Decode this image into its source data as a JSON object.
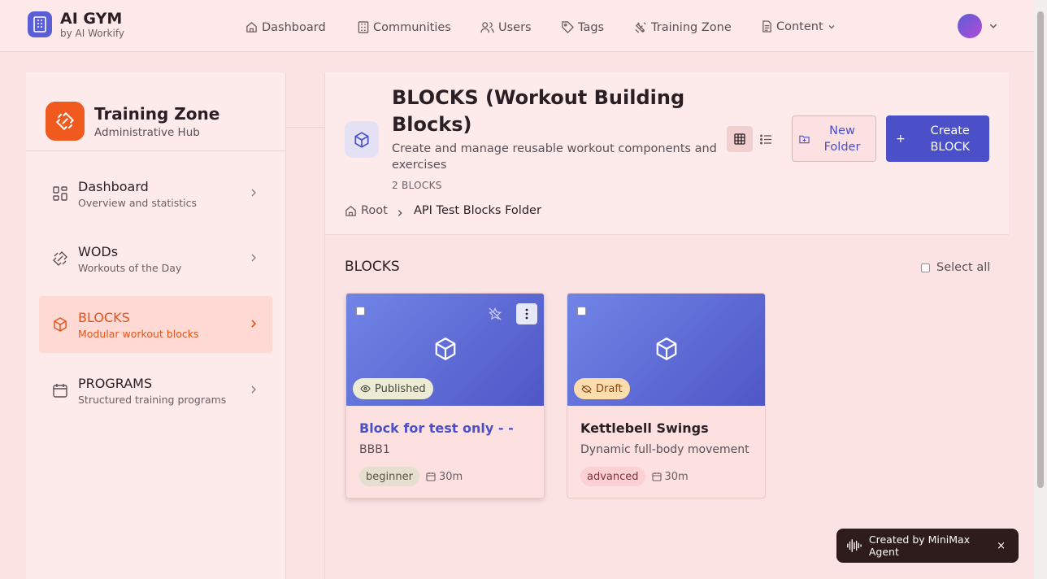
{
  "brand": {
    "title": "AI GYM",
    "subtitle": "by AI Workify"
  },
  "nav": {
    "dashboard": "Dashboard",
    "communities": "Communities",
    "users": "Users",
    "tags": "Tags",
    "training_zone": "Training Zone",
    "content": "Content"
  },
  "sidebar": {
    "title": "Training Zone",
    "subtitle": "Administrative Hub",
    "items": [
      {
        "label": "Dashboard",
        "desc": "Overview and statistics"
      },
      {
        "label": "WODs",
        "desc": "Workouts of the Day"
      },
      {
        "label": "BLOCKS",
        "desc": "Modular workout blocks"
      },
      {
        "label": "PROGRAMS",
        "desc": "Structured training programs"
      }
    ]
  },
  "header": {
    "title": "BLOCKS (Workout Building Blocks)",
    "description": "Create and manage reusable workout components and exercises",
    "count": "2 BLOCKS",
    "new_folder": "New Folder",
    "create": "Create BLOCK",
    "create_plus": "+"
  },
  "breadcrumb": {
    "root": "Root",
    "current": "API Test Blocks Folder"
  },
  "section": {
    "title": "BLOCKS",
    "select_all": "Select all"
  },
  "cards": [
    {
      "status": "Published",
      "title": "Block for test only - -",
      "subtitle": "BBB1",
      "level": "beginner",
      "duration": "30m"
    },
    {
      "status": "Draft",
      "title": "Kettlebell Swings",
      "subtitle": "Dynamic full-body movement",
      "level": "advanced",
      "duration": "30m"
    }
  ],
  "toast": {
    "text": "Created by MiniMax Agent",
    "close": "×"
  },
  "colors": {
    "accent": "#4b50c8",
    "brand_orange": "#f05a1e",
    "active_text": "#e5541b"
  }
}
